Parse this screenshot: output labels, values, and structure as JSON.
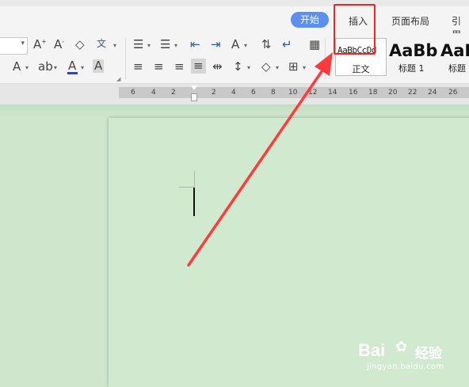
{
  "tabs": {
    "start": "开始",
    "insert": "插入",
    "page_layout": "页面布局",
    "references": "引用"
  },
  "toolbar": {
    "icons": [
      "increase-font-size",
      "decrease-font-size",
      "clear-format",
      "phonetic-guide",
      "text-effect",
      "highlight",
      "font-color",
      "char-shading",
      "bullet-list",
      "numbered-list",
      "decrease-indent",
      "increase-indent",
      "chinese-layout",
      "sort",
      "show-marks",
      "table",
      "align-left",
      "align-center",
      "align-right",
      "justify",
      "distributed",
      "line-spacing",
      "shading",
      "borders"
    ],
    "pinyin_glyph": "wén",
    "font_color_hex": "#1e40ff",
    "highlight_color_hex": "#ffd400"
  },
  "styles": {
    "normal_preview": "AaBbCcDd",
    "normal_label": "正文",
    "heading1_preview": "AaBb",
    "heading1_label": "标题 1",
    "heading2_preview": "AaE",
    "heading2_label": "标题"
  },
  "ruler": {
    "labels": [
      "6",
      "4",
      "2",
      "2",
      "4",
      "6",
      "8",
      "10",
      "12",
      "14",
      "16",
      "18",
      "20",
      "22",
      "24",
      "26"
    ]
  },
  "annotation": {
    "color": "#ff1f1f"
  },
  "watermark": {
    "brand": "Bai",
    "suffix": "经验",
    "url": "jingyan.baidu.com"
  }
}
